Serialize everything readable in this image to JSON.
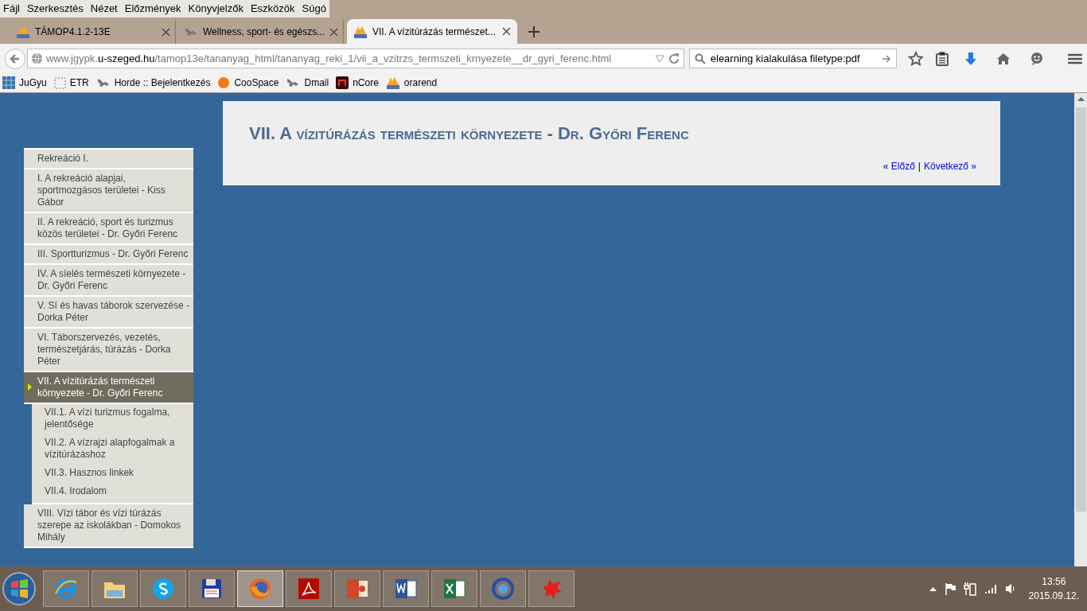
{
  "menu_bar": [
    "Fájl",
    "Szerkesztés",
    "Nézet",
    "Előzmények",
    "Könyvjelzők",
    "Eszközök",
    "Súgó"
  ],
  "tabs": [
    {
      "title": "TÁMOP4.1.2-13E",
      "selected": false,
      "kind": "pma"
    },
    {
      "title": "Wellness, sport- és egészs...",
      "selected": false,
      "kind": "horde"
    },
    {
      "title": "VII. A vízitúrázás természet...",
      "selected": true,
      "kind": "pma"
    }
  ],
  "address_bar": {
    "url": "www.jgypk.**u-szeged.hu**/tamop13e/tananyag_html/tananyag_reki_1/vii_a_vzitrzs_termszeti_krnyezete__dr_gyri_ferenc.html"
  },
  "search_field": {
    "value": "elearning kialakulása filetype:pdf"
  },
  "bookmarks": [
    {
      "label": "JuGyu",
      "kind": "grid"
    },
    {
      "label": "ETR",
      "kind": "blank"
    },
    {
      "label": "Horde :: Bejelentkezés",
      "kind": "horde"
    },
    {
      "label": "CooSpace",
      "kind": "ball"
    },
    {
      "label": "Dmail",
      "kind": "horde"
    },
    {
      "label": "nCore",
      "kind": "ncore"
    },
    {
      "label": "orarend",
      "kind": "pma"
    }
  ],
  "page": {
    "title": "VII. A vízitúrázás természeti környezete - Dr. Győri Ferenc",
    "prev_link": "« Előző",
    "separator": "|",
    "next_link": "Következő »"
  },
  "sidebar": {
    "items": [
      {
        "label": "Rekreáció I.",
        "selected": false
      },
      {
        "label": "I. A rekreáció alapjai, sportmozgásos területei - Kiss Gábor",
        "selected": false
      },
      {
        "label": "II. A rekreáció, sport és turizmus közös területei - Dr. Győri Ferenc",
        "selected": false
      },
      {
        "label": "III. Sportturizmus - Dr. Győri Ferenc",
        "selected": false
      },
      {
        "label": "IV. A síelés természeti környezete - Dr. Győri Ferenc",
        "selected": false
      },
      {
        "label": "V. Sí és havas táborok szervezése - Dorka Péter",
        "selected": false
      },
      {
        "label": "VI. Táborszervezés, vezetés, természetjárás, túrázás - Dorka Péter",
        "selected": false
      },
      {
        "label": "VII. A vízitúrázás természeti környezete - Dr. Győri Ferenc",
        "selected": true,
        "children": [
          {
            "label": "VII.1. A vízi turizmus fogalma, jelentősége"
          },
          {
            "label": "VII.2. A vízrajzi alapfogalmak a vízitúrázáshoz"
          },
          {
            "label": "VII.3. Hasznos linkek"
          },
          {
            "label": "VII.4. Irodalom"
          }
        ]
      },
      {
        "label": "VIII. Vízi tábor és vízi túrázás szerepe az iskolákban - Domokos Mihály",
        "selected": false
      }
    ]
  },
  "taskbar": {
    "apps": [
      {
        "kind": "ie",
        "selected": false
      },
      {
        "kind": "folder",
        "selected": false
      },
      {
        "kind": "skype",
        "selected": false
      },
      {
        "kind": "disk",
        "selected": false
      },
      {
        "kind": "firefox",
        "selected": true
      },
      {
        "kind": "pdf",
        "selected": false
      },
      {
        "kind": "powerpoint",
        "selected": false
      },
      {
        "kind": "word",
        "selected": false
      },
      {
        "kind": "excel",
        "selected": false
      },
      {
        "kind": "sync",
        "selected": false
      },
      {
        "kind": "splat",
        "selected": false
      }
    ],
    "clock": {
      "time": "13:56",
      "date": "2015.09.12."
    }
  }
}
